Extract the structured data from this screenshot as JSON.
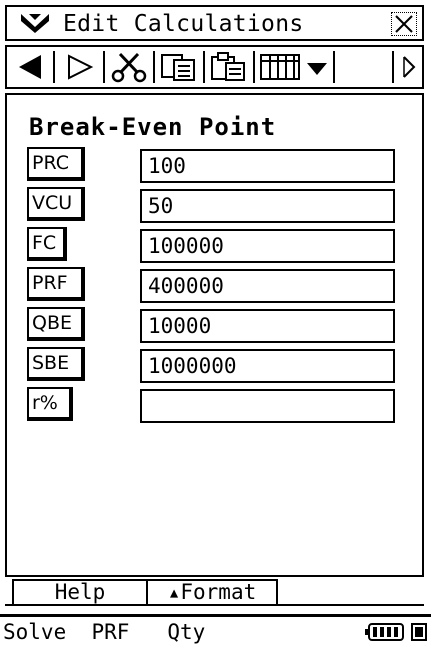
{
  "menu": {
    "title": "Edit Calculations"
  },
  "toolbar": {
    "icons": [
      "left-filled-arrow-icon",
      "play-outline-icon",
      "scissors-icon",
      "copy-icon",
      "paste-icon",
      "matrix-icon",
      "dropdown-arrow-icon",
      "scroll-right-icon"
    ]
  },
  "main": {
    "title": "Break-Even Point",
    "rows": [
      {
        "label": "PRC",
        "value": "100"
      },
      {
        "label": "VCU",
        "value": "50"
      },
      {
        "label": "FC",
        "value": "100000"
      },
      {
        "label": "PRF",
        "value": "400000"
      },
      {
        "label": "QBE",
        "value": "10000"
      },
      {
        "label": "SBE",
        "value": "1000000"
      },
      {
        "label": "r%",
        "value": ""
      }
    ]
  },
  "tabs": {
    "help": "Help",
    "format": "▴Format"
  },
  "status": {
    "text": "Solve  PRF   Qty"
  }
}
